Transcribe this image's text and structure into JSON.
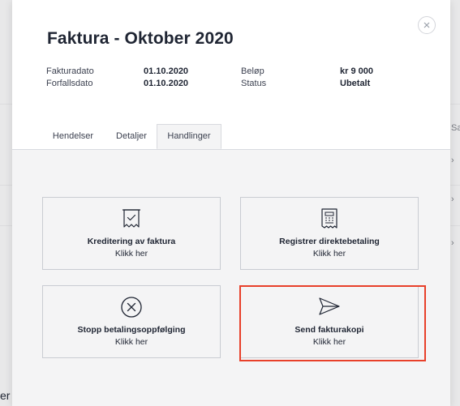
{
  "modal": {
    "title": "Faktura - Oktober 2020",
    "info": {
      "invoice_date_label": "Fakturadato",
      "invoice_date_value": "01.10.2020",
      "due_date_label": "Forfallsdato",
      "due_date_value": "01.10.2020",
      "amount_label": "Beløp",
      "amount_value": "kr 9 000",
      "status_label": "Status",
      "status_value": "Ubetalt"
    },
    "tabs": [
      {
        "label": "Hendelser",
        "active": false
      },
      {
        "label": "Detaljer",
        "active": false
      },
      {
        "label": "Handlinger",
        "active": true
      }
    ],
    "actions": [
      {
        "icon": "receipt-check-icon",
        "title": "Kreditering av faktura",
        "subtitle": "Klikk her"
      },
      {
        "icon": "invoice-document-icon",
        "title": "Registrer direktebetaling",
        "subtitle": "Klikk her"
      },
      {
        "icon": "stop-circle-x-icon",
        "title": "Stopp betalingsoppfølging",
        "subtitle": "Klikk her"
      },
      {
        "icon": "paper-plane-icon",
        "title": "Send fakturakopi",
        "subtitle": "Klikk her"
      }
    ]
  },
  "background": {
    "column_header_fragment": "Sa",
    "bottom_text_fragment": "er"
  },
  "colors": {
    "highlight": "#e8402a",
    "text": "#1f2533",
    "modal_body_bg": "#f4f4f5"
  }
}
